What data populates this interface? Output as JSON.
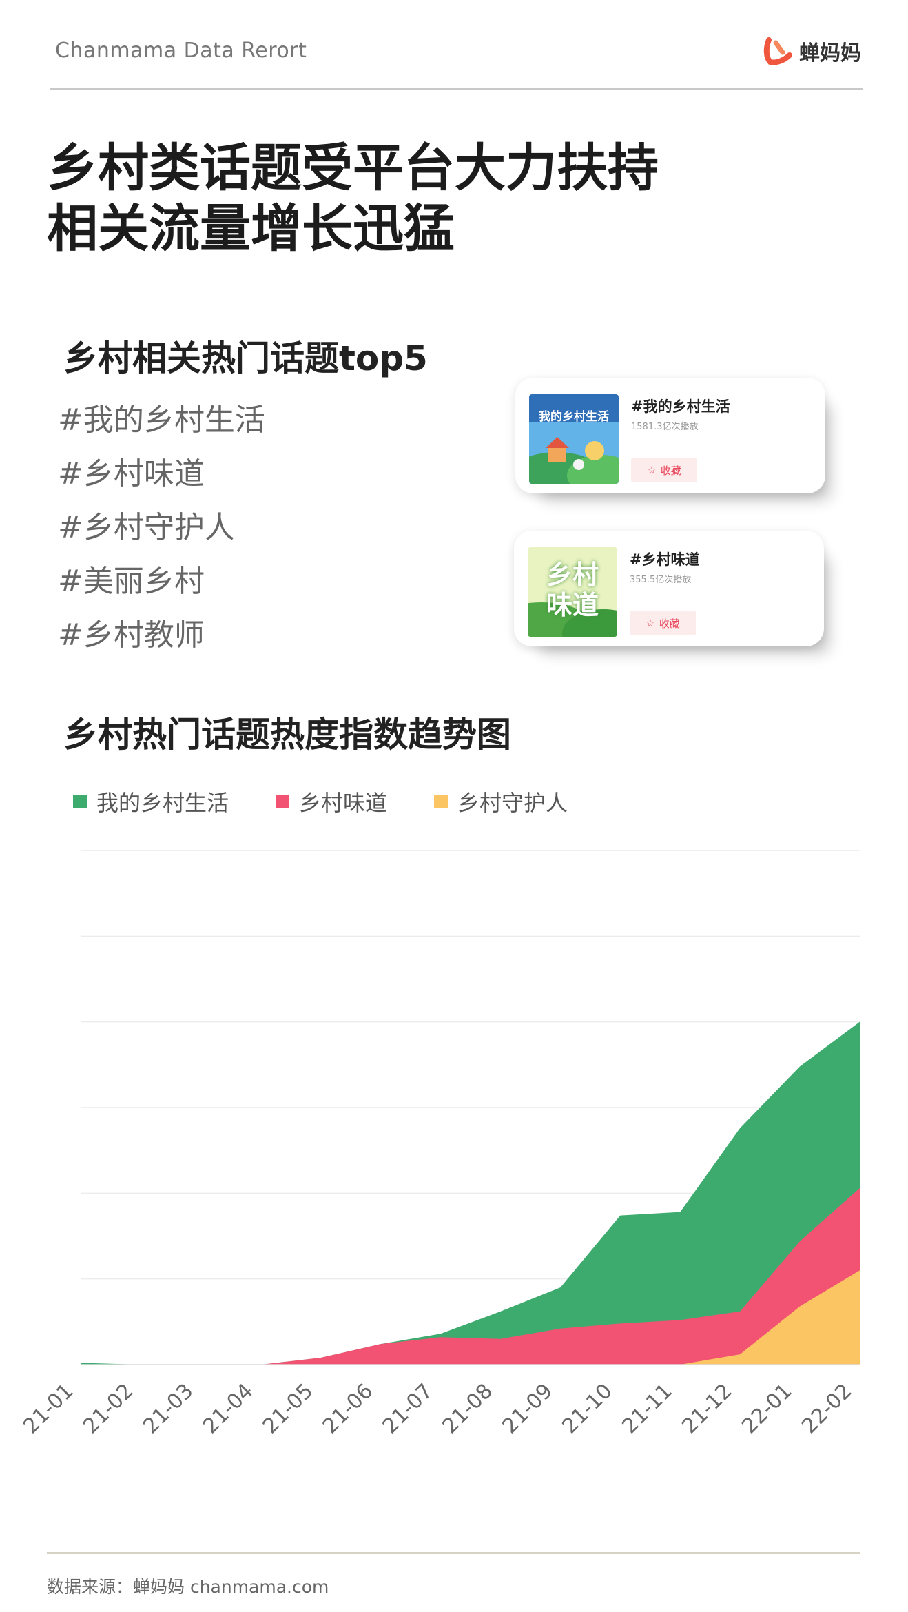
{
  "header": {
    "brand": "Chanmama Data Rerort",
    "logo_text": "蝉妈妈"
  },
  "title_lines": [
    "乡村类话题受平台大力扶持",
    "相关流量增长迅猛"
  ],
  "topics_section": {
    "title": "乡村相关热门话题top5",
    "items": [
      "#我的乡村生活",
      "#乡村味道",
      "#乡村守护人",
      "#美丽乡村",
      "#乡村教师"
    ]
  },
  "cards": [
    {
      "thumb_text": "我的乡村生活",
      "title": "#我的乡村生活",
      "plays": "1581.3亿次播放",
      "button": "收藏"
    },
    {
      "thumb_text": "乡村味道",
      "title": "#乡村味道",
      "plays": "355.5亿次播放",
      "button": "收藏"
    }
  ],
  "chart_section": {
    "title": "乡村热门话题热度指数趋势图"
  },
  "colors": {
    "green": "#3dab6e",
    "pink": "#f25372",
    "yellow": "#fcc564",
    "accent": "#e8465a"
  },
  "chart_data": {
    "type": "area",
    "stacked": true,
    "categories": [
      "21-01",
      "21-02",
      "21-03",
      "21-04",
      "21-05",
      "21-06",
      "21-07",
      "21-08",
      "21-09",
      "21-10",
      "21-11",
      "21-12",
      "22-01",
      "22-02"
    ],
    "series": [
      {
        "name": "我的乡村生活",
        "color": "#3dab6e",
        "values": [
          1,
          0,
          0,
          0,
          0,
          0,
          2,
          16,
          24,
          63,
          63,
          107,
          102,
          97
        ]
      },
      {
        "name": "乡村味道",
        "color": "#f25372",
        "values": [
          0,
          0,
          0,
          0,
          4,
          12,
          16,
          15,
          21,
          24,
          26,
          25,
          38,
          48
        ]
      },
      {
        "name": "乡村守护人",
        "color": "#fcc564",
        "values": [
          0,
          0,
          0,
          0,
          0,
          0,
          0,
          0,
          0,
          0,
          0,
          6,
          34,
          55
        ]
      }
    ],
    "ylim": [
      0,
      300
    ],
    "grid": true,
    "legend": "top-left"
  },
  "footer": {
    "source": "数据来源：蝉妈妈 chanmama.com"
  }
}
